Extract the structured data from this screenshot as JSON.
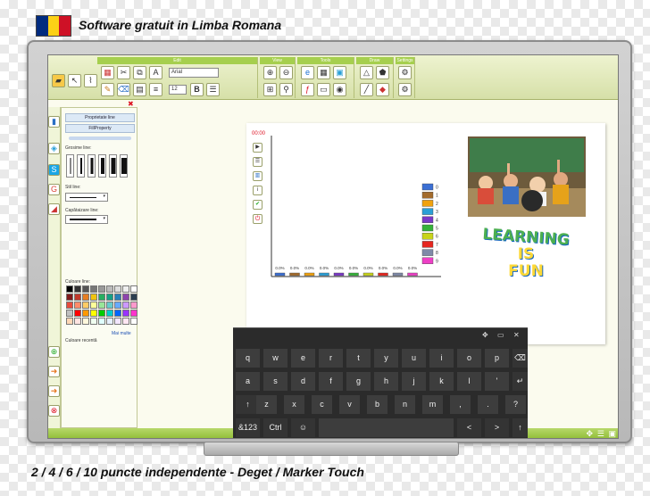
{
  "header": {
    "title": "Software gratuit in Limba Romana",
    "flag_colors": [
      "#002B7F",
      "#FCD116",
      "#CE1126"
    ]
  },
  "footer": {
    "caption": "2 / 4 / 6 / 10 puncte independente - Deget / Marker Touch"
  },
  "toolbar": {
    "groups": [
      "Edit",
      "View",
      "Tools",
      "Draw",
      "Settings"
    ],
    "font_name": "Arial",
    "font_size": "12",
    "bold_label": "B"
  },
  "panel": {
    "button_line_props": "Proprietate line",
    "button_fill_props": "FillProperty",
    "label_thickness": "Grosime line:",
    "label_style": "Stil line:",
    "label_end": "Capătaizare line:",
    "label_colors": "Culoare line:",
    "label_recent": "Culoare recentă",
    "more_colors": "Mai multe",
    "palette": [
      "#000000",
      "#333333",
      "#555555",
      "#777777",
      "#999999",
      "#bbbbbb",
      "#dddddd",
      "#eeeeee",
      "#ffffff",
      "#7f1a1a",
      "#c0392b",
      "#e67e22",
      "#f1c40f",
      "#27ae60",
      "#16a085",
      "#2980b9",
      "#8e44ad",
      "#2c3e50",
      "#e74c3c",
      "#ff8c69",
      "#ffcc66",
      "#ffff99",
      "#99e699",
      "#66cccc",
      "#66aaff",
      "#cc99ff",
      "#ff99cc",
      "#c0c0c0",
      "#ff0000",
      "#ff9900",
      "#ffff00",
      "#00cc00",
      "#00cccc",
      "#0066ff",
      "#9933ff",
      "#ff33cc",
      "#ffd7b5",
      "#ffe4e1",
      "#fff8dc",
      "#f0fff0",
      "#e0ffff",
      "#e6f0ff",
      "#f3e6ff",
      "#ffe6f3",
      "#ffffff"
    ]
  },
  "chart_data": {
    "type": "bar",
    "timer": "00:00",
    "categories": [
      "0",
      "1",
      "2",
      "3",
      "4",
      "5",
      "6",
      "7",
      "8",
      "9"
    ],
    "values": [
      0,
      0,
      0,
      0,
      0,
      0,
      0,
      0,
      0,
      0
    ],
    "value_labels": [
      "0.0%",
      "0.0%",
      "0.0%",
      "0.0%",
      "0.0%",
      "0.0%",
      "0.0%",
      "0.0%",
      "0.0%",
      "0.0%"
    ],
    "colors": [
      "#3b6fd4",
      "#a36b2c",
      "#f1a20e",
      "#2a9fd6",
      "#7a39c7",
      "#36b23a",
      "#c8d41a",
      "#e6261f",
      "#7f8aa8",
      "#ee3fc6"
    ],
    "grid": false,
    "legend": "top-right"
  },
  "wordart": {
    "line1": "LEARNING",
    "line2": "IS",
    "line3": "FUN"
  },
  "keyboard": {
    "top_icons": [
      "move-icon",
      "dock-icon",
      "close-icon"
    ],
    "row1": [
      "q",
      "w",
      "e",
      "r",
      "t",
      "y",
      "u",
      "i",
      "o",
      "p"
    ],
    "row2": [
      "a",
      "s",
      "d",
      "f",
      "g",
      "h",
      "j",
      "k",
      "l",
      "'"
    ],
    "row3": [
      "z",
      "x",
      "c",
      "v",
      "b",
      "n",
      "m",
      ",",
      ".",
      "?"
    ],
    "special": {
      "symbols": "&123",
      "ctrl": "Ctrl",
      "emoji": "☺",
      "left": "<",
      "right": ">",
      "shift": "↑",
      "backspace": "⌫",
      "enter": "↵"
    }
  }
}
